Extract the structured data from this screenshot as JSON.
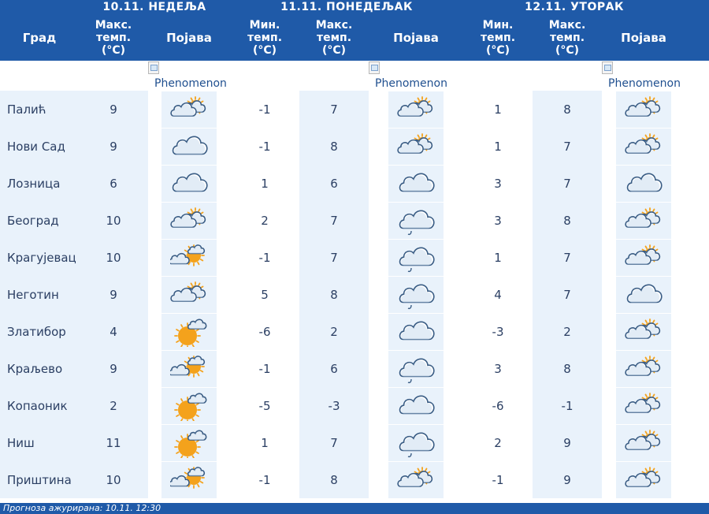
{
  "days": [
    {
      "label": "10.11. НЕДЕЉА"
    },
    {
      "label": "11.11. ПОНЕДЕЉАК"
    },
    {
      "label": "12.11. УТОРАК"
    }
  ],
  "headers": {
    "city": "Град",
    "max": [
      "Макс.",
      "темп.",
      "(°C)"
    ],
    "min": [
      "Мин.",
      "темп.",
      "(°C)"
    ],
    "phenomenon": "Појава"
  },
  "legend_alt": "Phenomenon",
  "rows": [
    {
      "city": "Палић",
      "d1_max": "9",
      "d1_icon": "partly-cloudy-sun-icon",
      "d2_min": "-1",
      "d2_max": "7",
      "d2_icon": "partly-cloudy-sun-icon",
      "d3_min": "1",
      "d3_max": "8",
      "d3_icon": "partly-cloudy-sun-icon"
    },
    {
      "city": "Нови Сад",
      "d1_max": "9",
      "d1_icon": "cloud-icon",
      "d2_min": "-1",
      "d2_max": "8",
      "d2_icon": "partly-cloudy-sun-icon",
      "d3_min": "1",
      "d3_max": "7",
      "d3_icon": "partly-cloudy-sun-icon"
    },
    {
      "city": "Лозница",
      "d1_max": "6",
      "d1_icon": "cloud-icon",
      "d2_min": "1",
      "d2_max": "6",
      "d2_icon": "cloud-icon",
      "d3_min": "3",
      "d3_max": "7",
      "d3_icon": "cloud-icon"
    },
    {
      "city": "Београд",
      "d1_max": "10",
      "d1_icon": "partly-cloudy-sun-icon",
      "d2_min": "2",
      "d2_max": "7",
      "d2_icon": "cloud-drizzle-icon",
      "d3_min": "3",
      "d3_max": "8",
      "d3_icon": "partly-cloudy-sun-icon"
    },
    {
      "city": "Крагујевац",
      "d1_max": "10",
      "d1_icon": "sun-cloud-icon",
      "d2_min": "-1",
      "d2_max": "7",
      "d2_icon": "cloud-drizzle-icon",
      "d3_min": "1",
      "d3_max": "7",
      "d3_icon": "partly-cloudy-sun-icon"
    },
    {
      "city": "Неготин",
      "d1_max": "9",
      "d1_icon": "partly-cloudy-sun-icon",
      "d2_min": "5",
      "d2_max": "8",
      "d2_icon": "cloud-drizzle-icon",
      "d3_min": "4",
      "d3_max": "7",
      "d3_icon": "cloud-icon"
    },
    {
      "city": "Златибор",
      "d1_max": "4",
      "d1_icon": "sun-small-cloud-icon",
      "d2_min": "-6",
      "d2_max": "2",
      "d2_icon": "cloud-icon",
      "d3_min": "-3",
      "d3_max": "2",
      "d3_icon": "partly-cloudy-sun-icon"
    },
    {
      "city": "Краљево",
      "d1_max": "9",
      "d1_icon": "sun-cloud-icon",
      "d2_min": "-1",
      "d2_max": "6",
      "d2_icon": "cloud-drizzle-icon",
      "d3_min": "3",
      "d3_max": "8",
      "d3_icon": "partly-cloudy-sun-icon"
    },
    {
      "city": "Копаоник",
      "d1_max": "2",
      "d1_icon": "sun-small-cloud-icon",
      "d2_min": "-5",
      "d2_max": "-3",
      "d2_icon": "cloud-icon",
      "d3_min": "-6",
      "d3_max": "-1",
      "d3_icon": "partly-cloudy-sun-icon"
    },
    {
      "city": "Ниш",
      "d1_max": "11",
      "d1_icon": "sun-small-cloud-icon",
      "d2_min": "1",
      "d2_max": "7",
      "d2_icon": "cloud-drizzle-icon",
      "d3_min": "2",
      "d3_max": "9",
      "d3_icon": "partly-cloudy-sun-icon"
    },
    {
      "city": "Приштина",
      "d1_max": "10",
      "d1_icon": "sun-cloud-icon",
      "d2_min": "-1",
      "d2_max": "8",
      "d2_icon": "partly-cloudy-sun-icon",
      "d3_min": "-1",
      "d3_max": "9",
      "d3_icon": "partly-cloudy-sun-icon"
    }
  ],
  "footer": "Прогноза ажурирана:  10.11.  12:30",
  "colors": {
    "header_bg": "#1f5aa8",
    "row_bg": "#e9f2fb",
    "text": "#2b3f63",
    "sun": "#f4a21c",
    "cloud_outline": "#3a5d85"
  }
}
